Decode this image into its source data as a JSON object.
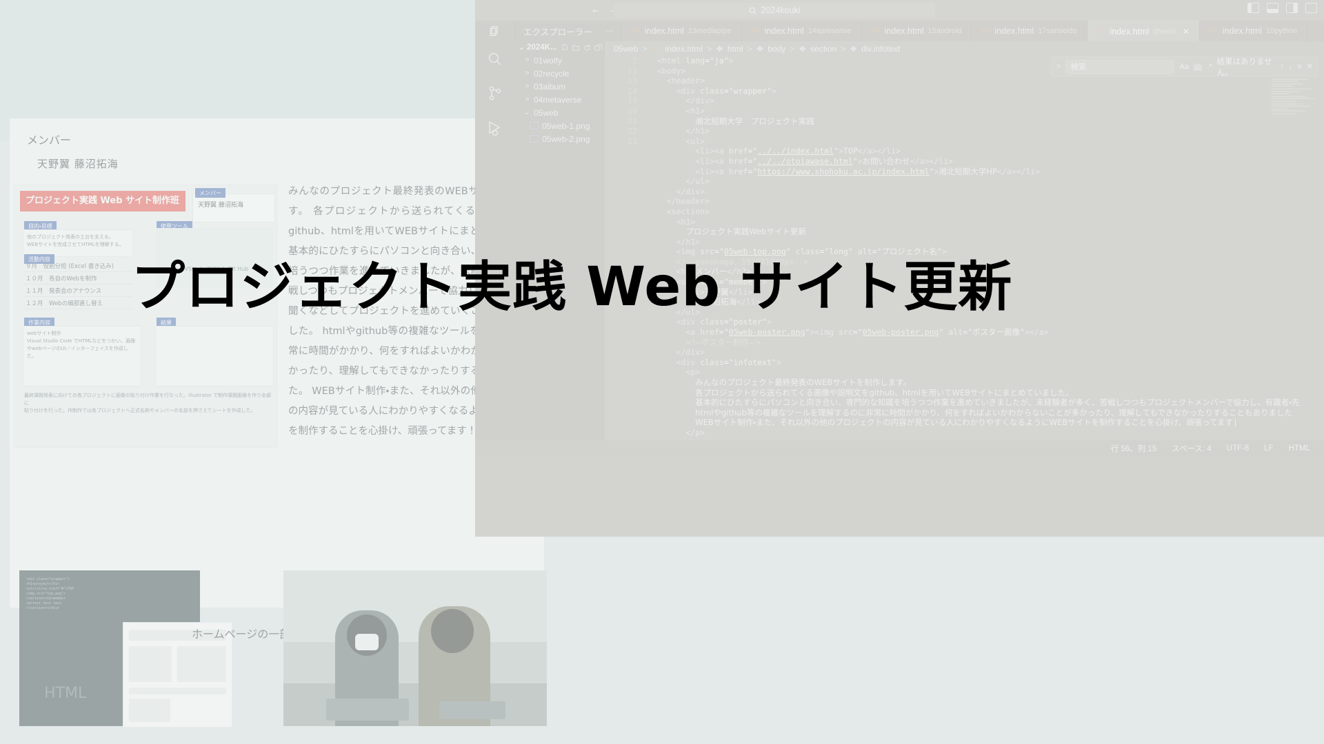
{
  "overlay": {
    "headline": "プロジェクト実践 Web サイト更新"
  },
  "slide": {
    "section_label": "メンバー",
    "members": "天野翼 藤沼拓海",
    "body_text": "みんなのプロジェクト最終発表のWEBサイトを制作します。 各プロジェクトから送られてくる画像や説明文をgithub、htmlを用いてWEBサイトにまとめていました。 基本的にひたすらにパソコンと向き合い、専門的な知識を培うつつ作業を進めていきましたが、未経験者が多く、苦戦しつつもプロジェクトメンバーで協力し、有識者・先生に聞くなどしてプロジェクトを進めていくことができていました。 htmlやgithub等の複雑なツールを理解するのに非常に時間がかかり、何をすればよいかわからないことが多かったり、理解してもできなかったりすることもありました。 WEBサイト制作・また、それ以外の他のプロジェクトの内容が見ている人にわかりやすくなるようにWEBサイトを制作することを心掛け、頑張ってます！",
    "mini_poster": {
      "banner": "プロジェクト実践 Web サイト制作班",
      "member_caption": "メンバー",
      "member_names": "天野翼  藤沼拓海",
      "purpose_caption": "目的・目標",
      "purpose_text": "他のプロジェクト発表の土台を支える。\nWEBサイトを完成させてHTMLを理解する。",
      "tool_caption": "使用ツール",
      "tool_names": "VScode      GitHub      Git Hub",
      "schedule_caption": "活動内容",
      "schedule": [
        {
          "month": "９月",
          "task": "役割分担 (Excel 書き込み)"
        },
        {
          "month": "１０月",
          "task": "各自のWebを制作"
        },
        {
          "month": "１１月",
          "task": "発表会のアナウンス"
        },
        {
          "month": "１２月",
          "task": "Webの細部直し替え"
        }
      ],
      "detail_caption": "作業内容",
      "detail_text": "webサイト制作\nVisual Studio Code でHTMLなどをつかい、画像やwebページのUI／インターフェイスを作成した。",
      "detail_caption2": "結果",
      "detail_text2": "最終課題発表に向けての各プロジェクトに画像の貼り付け作業を行なった。Illustrator で制作課題画像を作り全部に\n貼り付けを行った。作制作では各プロジェクトへ正式名称やメンバーの名前を押さえてシートを作成した。"
    },
    "photo_labels": {
      "html": "HTML",
      "homepage": "ホームページの一部"
    }
  },
  "vscode": {
    "titlebar": {
      "back_arrow": "←",
      "forward_arrow": "→",
      "search_icon": "search-icon",
      "search_value": "2024kouki",
      "layout_buttons": [
        "toggle-primary-sidebar",
        "toggle-panel",
        "toggle-secondary-sidebar",
        "customize-layout"
      ]
    },
    "explorer": {
      "title": "エクスプローラー",
      "more": "···",
      "root": "2024K...",
      "actions": [
        "new-file",
        "new-folder",
        "refresh",
        "collapse-all"
      ],
      "items": [
        {
          "label": "01wolfy",
          "type": "folder",
          "expanded": false
        },
        {
          "label": "02recycle",
          "type": "folder",
          "expanded": false
        },
        {
          "label": "03album",
          "type": "folder",
          "expanded": false
        },
        {
          "label": "04metaverse",
          "type": "folder",
          "expanded": false
        },
        {
          "label": "05web",
          "type": "folder",
          "expanded": true
        },
        {
          "label": "05web-1.png",
          "type": "image"
        },
        {
          "label": "05web-2.png",
          "type": "image"
        }
      ]
    },
    "tabs": [
      {
        "name": "index.html",
        "ext": "13mediapipe",
        "active": false
      },
      {
        "name": "index.html",
        "ext": "14spresense",
        "active": false
      },
      {
        "name": "index.html",
        "ext": "15android",
        "active": false
      },
      {
        "name": "index.html",
        "ext": "17sanseido",
        "active": false
      },
      {
        "name": "index.html",
        "ext": "05web",
        "active": true,
        "close": "✕"
      },
      {
        "name": "index.html",
        "ext": "10python",
        "active": false
      }
    ],
    "breadcrumb": [
      "05web",
      "index.html",
      "html",
      "body",
      "section",
      "div.infotext"
    ],
    "find": {
      "placeholder": "検索",
      "match_case": "Aa",
      "whole_word": "ab",
      "regex": ".*",
      "result": "結果はありません。",
      "prev": "↑",
      "next": "↓",
      "select_all": "≡",
      "close": "✕"
    },
    "code_lines": [
      {
        "no": "2",
        "indent": 1,
        "html": "<span class='tag'>&lt;html</span> <span class='attr'>lang</span>=<span class='str'>\"ja\"</span><span class='tag'>&gt;</span>"
      },
      {
        "no": "11",
        "indent": 1,
        "html": "<span class='tag'>&lt;body&gt;</span>"
      },
      {
        "no": "13",
        "indent": 2,
        "html": "<span class='tag'>&lt;header&gt;</span>"
      },
      {
        "no": "14",
        "indent": 3,
        "html": "<span class='tag'>&lt;div</span> <span class='attr'>class</span>=<span class='str'>\"wrapper\"</span><span class='tag'>&gt;</span>"
      },
      {
        "no": "19",
        "indent": 4,
        "html": "<span class='tag'>&lt;/div&gt;</span>"
      },
      {
        "no": "20",
        "indent": 4,
        "html": "<span class='tag'>&lt;h1&gt;</span>"
      },
      {
        "no": "21",
        "indent": 5,
        "html": "<span class='tk jp'>湘北短期大学　プロジェクト実践</span>"
      },
      {
        "no": "22",
        "indent": 4,
        "html": "<span class='tag'>&lt;/h1&gt;</span>"
      },
      {
        "no": "23",
        "indent": 4,
        "html": "<span class='tag'>&lt;ul&gt;</span>"
      },
      {
        "no": "",
        "indent": 5,
        "html": "<span class='tag'>&lt;li&gt;&lt;a</span> <span class='attr'>href</span>=<span class='str'>\"<span class='lnk'>../../index.html</span>\"</span><span class='tag'>&gt;</span><span class='tk'>TOP</span><span class='tag'>&lt;/a&gt;&lt;/li&gt;</span>"
      },
      {
        "no": "",
        "indent": 5,
        "html": "<span class='tag'>&lt;li&gt;&lt;a</span> <span class='attr'>href</span>=<span class='str'>\"<span class='lnk'>../../otoiawase.html</span>\"</span><span class='tag'>&gt;</span><span class='tk jp'>お問い合わせ</span><span class='tag'>&lt;/a&gt;&lt;/li&gt;</span>"
      },
      {
        "no": "",
        "indent": 5,
        "html": "<span class='tag'>&lt;li&gt;&lt;a</span> <span class='attr'>href</span>=<span class='str'>\"<span class='lnk'>https://www.shohoku.ac.jp/index.html</span>\"</span><span class='tag'>&gt;</span><span class='tk jp'>湘北短期大学HP</span><span class='tag'>&lt;/a&gt;&lt;/li&gt;</span>"
      },
      {
        "no": "",
        "indent": 4,
        "html": "<span class='tag'>&lt;/ul&gt;</span>"
      },
      {
        "no": "",
        "indent": 3,
        "html": "<span class='tag'>&lt;/div&gt;</span>"
      },
      {
        "no": "",
        "indent": 2,
        "html": "<span class='tag'>&lt;/header&gt;</span>"
      },
      {
        "no": "",
        "indent": 0,
        "html": ""
      },
      {
        "no": "",
        "indent": 2,
        "html": "<span class='tag'>&lt;section&gt;</span>"
      },
      {
        "no": "",
        "indent": 3,
        "html": "<span class='tag'>&lt;h1&gt;</span>"
      },
      {
        "no": "",
        "indent": 4,
        "html": "<span class='tk jp'>プロジェクト実践Webサイト更新</span>"
      },
      {
        "no": "",
        "indent": 3,
        "html": "<span class='tag'>&lt;/h1&gt;</span>"
      },
      {
        "no": "",
        "indent": 3,
        "html": "<span class='tag'>&lt;img</span> <span class='attr'>src</span>=<span class='str'>\"<span class='lnk'>05web-top.png</span>\"</span> <span class='attr'>class</span>=<span class='str'>\"long\"</span> <span class='attr'>alt</span>=<span class='str'>\"<span class='jp'>プロジェクト名</span>\"</span><span class='tag'>&gt;</span>"
      },
      {
        "no": "",
        "indent": 3,
        "html": "<span class='cmt'>&lt;!--yokonaga、1920X1080px--&gt;</span>"
      },
      {
        "no": "",
        "indent": 0,
        "html": ""
      },
      {
        "no": "",
        "indent": 3,
        "html": "<span class='tag'>&lt;h2&gt;</span><span class='tk jp'>メンバー</span><span class='tag'>&lt;/h2&gt;</span>"
      },
      {
        "no": "",
        "indent": 3,
        "html": "<span class='tag'>&lt;ul</span> <span class='attr'>class</span>=<span class='str'>\"member\"</span><span class='tag'>&gt;</span>"
      },
      {
        "no": "",
        "indent": 4,
        "html": "<span class='tag'>&lt;li&gt;</span><span class='tk jp'>天野翼</span><span class='tag'>&lt;/li&gt;</span>"
      },
      {
        "no": "",
        "indent": 4,
        "html": "<span class='tag'>&lt;li&gt;</span><span class='tk jp'>藤沼拓海</span><span class='tag'>&lt;/li&gt;</span>"
      },
      {
        "no": "",
        "indent": 3,
        "html": "<span class='tag'>&lt;/ul&gt;</span>"
      },
      {
        "no": "",
        "indent": 0,
        "html": ""
      },
      {
        "no": "",
        "indent": 3,
        "html": "<span class='tag'>&lt;div</span> <span class='attr'>class</span>=<span class='str'>\"poster\"</span><span class='tag'>&gt;</span>"
      },
      {
        "no": "",
        "indent": 4,
        "html": "<span class='tag'>&lt;a</span> <span class='attr'>href</span>=<span class='str'>\"<span class='lnk'>05web-poster.png</span>\"</span><span class='tag'>&gt;&lt;img</span> <span class='attr'>src</span>=<span class='str'>\"<span class='lnk'>05web-poster.png</span>\"</span> <span class='attr'>alt</span>=<span class='str'>\"<span class='jp'>ポスター画像</span>\"</span><span class='tag'>&gt;&lt;/a&gt;</span>"
      },
      {
        "no": "",
        "indent": 4,
        "html": "<span class='cmt jp'>&lt;!--ポスター制作--&gt;</span>"
      },
      {
        "no": "",
        "indent": 3,
        "html": "<span class='tag'>&lt;/div&gt;</span>"
      },
      {
        "no": "",
        "indent": 3,
        "html": "<span class='tag'>&lt;div</span> <span class='attr'>class</span>=<span class='str'>\"infotext\"</span><span class='tag'>&gt;</span>"
      },
      {
        "no": "",
        "indent": 4,
        "html": "<span class='tag'>&lt;p&gt;</span>"
      },
      {
        "no": "",
        "indent": 5,
        "html": "<span class='tk jp'>みんなのプロジェクト最終発表のWEBサイトを制作します。</span>"
      },
      {
        "no": "",
        "indent": 5,
        "html": "<span class='tk jp'>各プロジェクトから送られてくる画像や説明文をgithub、htmlを用いてWEBサイトにまとめていました。</span>"
      },
      {
        "no": "",
        "indent": 5,
        "html": "<span class='tk jp'>基本的にひたすらにパソコンと向き合い、専門的な知識を培うつつ作業を進めていきましたが、未経験者が多く、苦戦しつつもプロジェクトメンバーで協力し、有識者・先</span>"
      },
      {
        "no": "",
        "indent": 5,
        "html": "<span class='tk jp'>htmlやgithub等の複雑なツールを理解するのに非常に時間がかかり、何をすればよいかわからないことが多かったり、理解してもできなかったりすることもありました</span>"
      },
      {
        "no": "",
        "indent": 5,
        "html": "<span class='tk jp'>WEBサイト制作・また、それ以外の他のプロジェクトの内容が見ている人にわかりやすくなるようにWEBサイトを制作することを心掛け、頑張ってます</span><span class='tk'>|</span>"
      },
      {
        "no": "",
        "indent": 4,
        "html": "<span class='tag'>&lt;/p&gt;</span>"
      },
      {
        "no": "",
        "indent": 3,
        "html": "<span class='tag'>&lt;/div&gt;</span>"
      }
    ],
    "statusbar": {
      "cursor": "行 56、列 15",
      "spaces": "スペース: 4",
      "encoding": "UTF-8",
      "eol": "LF",
      "language": "HTML"
    }
  }
}
